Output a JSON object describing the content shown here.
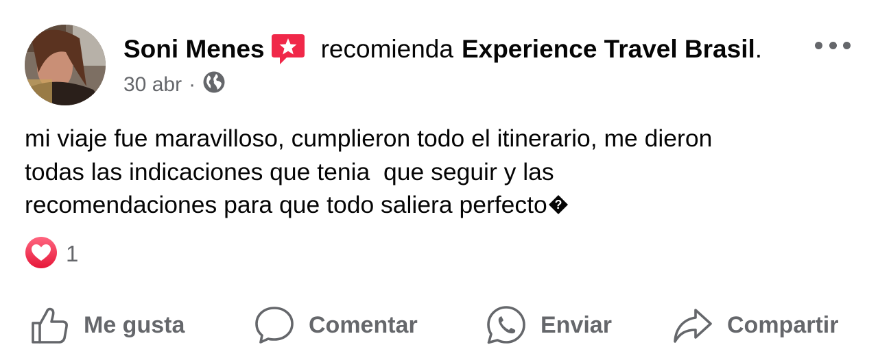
{
  "post": {
    "author": "Soni Menes",
    "recommend_text": "recomienda",
    "page_name": "Experience Travel Brasil",
    "page_suffix": ".",
    "date": "30 abr",
    "separator": "·",
    "body": "mi viaje fue maravilloso, cumplieron todo el itinerario, me dieron\ntodas las indicaciones que tenia  que seguir y las\nrecomendaciones para que todo saliera perfecto",
    "unknown_glyph": "?"
  },
  "icons": {
    "recommend": "recommend-star-icon",
    "audience": "globe-icon",
    "more": "ellipsis-icon",
    "reaction": "heart-icon",
    "like": "thumbs-up-icon",
    "comment": "comment-bubble-icon",
    "send": "whatsapp-icon",
    "share": "share-arrow-icon"
  },
  "reactions": {
    "count": "1"
  },
  "actions": {
    "like_label": "Me gusta",
    "comment_label": "Comentar",
    "send_label": "Enviar",
    "share_label": "Compartir"
  },
  "colors": {
    "text_primary": "#050505",
    "text_secondary": "#65676b",
    "recommend_badge": "#f02849",
    "heart": "#f33e58"
  }
}
